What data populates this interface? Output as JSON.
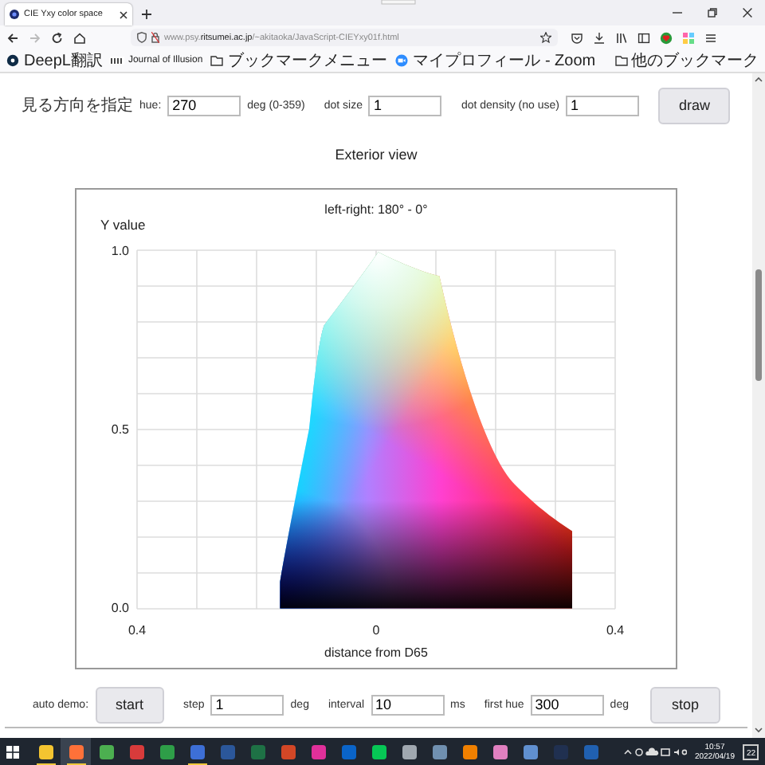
{
  "browser": {
    "tab": {
      "title": "CIE Yxy color space",
      "selected": true
    },
    "nav_buttons": [
      {
        "kind": "back",
        "disabled": false
      },
      {
        "kind": "forward",
        "disabled": true
      },
      {
        "kind": "reload",
        "disabled": false
      },
      {
        "kind": "home",
        "disabled": false
      }
    ],
    "address": {
      "url_prefix": "www.psy.",
      "url_domain": "ritsumei.ac.jp",
      "url_path": "/~akitaoka/JavaScript-CIEYxy01f.html"
    },
    "bookmarks": [
      {
        "kind": "deepl",
        "label": "DeepL翻訳"
      },
      {
        "kind": "pdf",
        "label": "Journal of Illusion"
      },
      {
        "kind": "folder",
        "label": "ブックマークメニュー"
      },
      {
        "kind": "zoom",
        "label": "マイプロフィール - Zoom"
      }
    ],
    "other_bookmarks": "他のブックマーク"
  },
  "view_controls": {
    "direction_label": "見る方向を指定",
    "hue_label": "hue:",
    "hue_value": "270",
    "hue_unit": "deg (0-359)",
    "dot_size_label": "dot size",
    "dot_size_value": "1",
    "dot_density_label": "dot density (no use)",
    "dot_density_value": "1",
    "draw_button": "draw"
  },
  "heading": "Exterior view",
  "plot": {
    "title": "left-right: 180° - 0°",
    "ylabel": "Y value",
    "yticks": [
      "1.0",
      "0.5",
      "0.0"
    ],
    "xticks": [
      "0.4",
      "0",
      "0.4"
    ],
    "xlabel": "distance from D65"
  },
  "auto_demo": {
    "label": "auto demo:",
    "start_button": "start",
    "step_label": "step",
    "step_value": "1",
    "step_unit": "deg",
    "interval_label": "interval",
    "interval_value": "10",
    "interval_unit": "ms",
    "first_hue_label": "first hue",
    "first_hue_value": "300",
    "first_hue_unit": "deg",
    "stop_button": "stop"
  },
  "taskbar": {
    "apps": [
      {
        "color": "#f4c430",
        "running": true,
        "selected": false
      },
      {
        "color": "#ff7139",
        "running": true,
        "selected": true
      },
      {
        "color": "#4caf50",
        "running": false,
        "selected": false
      },
      {
        "color": "#d83b3b",
        "running": false,
        "selected": false
      },
      {
        "color": "#2e9e48",
        "running": false,
        "selected": false
      },
      {
        "color": "#3d6fd6",
        "running": true,
        "selected": false
      },
      {
        "color": "#2b579a",
        "running": false,
        "selected": false
      },
      {
        "color": "#1e7145",
        "running": false,
        "selected": false
      },
      {
        "color": "#d24726",
        "running": false,
        "selected": false
      },
      {
        "color": "#e0309a",
        "running": false,
        "selected": false
      },
      {
        "color": "#0a64c8",
        "running": false,
        "selected": false
      },
      {
        "color": "#06c755",
        "running": false,
        "selected": false
      },
      {
        "color": "#a0a8b0",
        "running": false,
        "selected": false
      },
      {
        "color": "#7090b0",
        "running": false,
        "selected": false
      },
      {
        "color": "#f08000",
        "running": false,
        "selected": false
      },
      {
        "color": "#e080c0",
        "running": false,
        "selected": false
      },
      {
        "color": "#6090d0",
        "running": false,
        "selected": false
      },
      {
        "color": "#203050",
        "running": false,
        "selected": false
      },
      {
        "color": "#2060b0",
        "running": false,
        "selected": false
      }
    ],
    "time": "10:57",
    "date": "2022/04/19",
    "notifications": "22"
  }
}
